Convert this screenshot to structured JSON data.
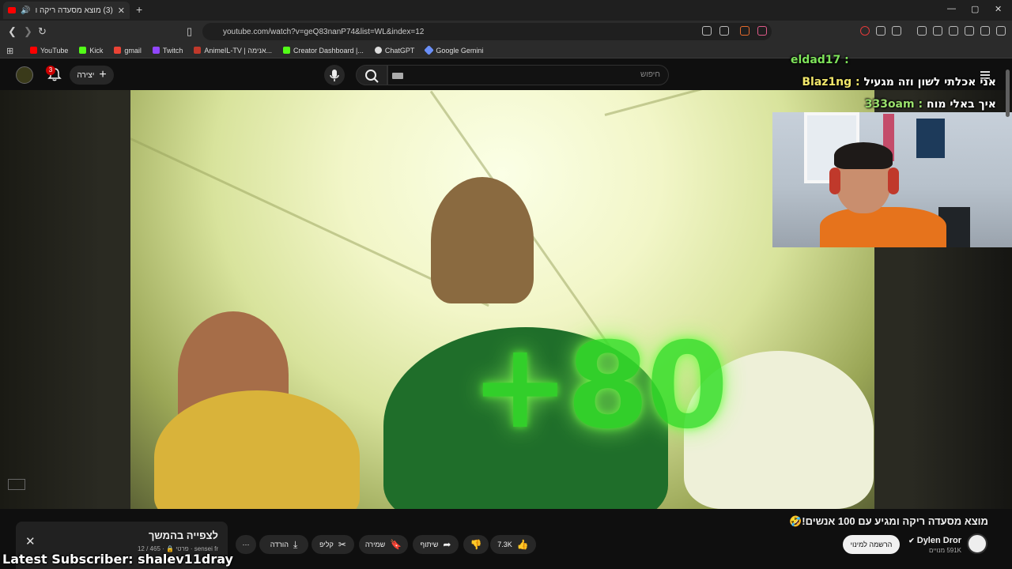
{
  "browser": {
    "tab_title": "(3) מוצא מסעדה ריקה ומגיע ע",
    "new_tab": "+",
    "url": "youtube.com/watch?v=geQ83nanP74&list=WL&index=12",
    "window_controls": [
      "—",
      "▢",
      "✕"
    ],
    "bookmarks": [
      {
        "label": "YouTube",
        "color": "#ff0000"
      },
      {
        "label": "Kick",
        "color": "#53fc18"
      },
      {
        "label": "gmail",
        "color": "#ea4335"
      },
      {
        "label": "Twitch",
        "color": "#9146ff"
      },
      {
        "label": "AnimeIL-TV | אנימה...",
        "color": "#c0392b"
      },
      {
        "label": "Creator Dashboard |...",
        "color": "#53fc18"
      },
      {
        "label": "ChatGPT",
        "color": "#dddddd"
      },
      {
        "label": "Google Gemini",
        "color": "#6a8ff7"
      }
    ]
  },
  "youtube": {
    "notifications_count": "3",
    "create_label": "יצירה",
    "search_placeholder": "חיפוש",
    "video_overlay_text": "+80",
    "video_title": "מוצא מסעדה ריקה ומגיע עם 100 אנשים!🤣",
    "channel_name": "Dylen Dror",
    "subscribers": "591K מנויים",
    "subscribe_label": "הרשמה למינוי",
    "likes": "7.3K",
    "share_label": "שיתוף",
    "save_label": "שמירה",
    "clip_label": "קליפ",
    "download_label": "הורדה",
    "more_label": "⋯"
  },
  "up_next": {
    "title": "לצפייה בהמשך",
    "meta": "sensei fr · פרטי 🔒 · 465 / 12"
  },
  "stream_overlay": {
    "chat": [
      {
        "user": "eldad17",
        "message": "",
        "color": "#7ee35a"
      },
      {
        "user": "Blaz1ng",
        "message": "אני אכלתי לשון וזה מגעיל",
        "color": "#f2e76b"
      },
      {
        "user": "333oam",
        "message": "איך באלי מוח",
        "color": "#9ae06c"
      }
    ],
    "latest_subscriber": "Latest Subscriber: shalev11dray",
    "youtube_badge": "YouTube"
  },
  "colors": {
    "accent_green": "#36e02a",
    "youtube_red": "#ff0000"
  }
}
